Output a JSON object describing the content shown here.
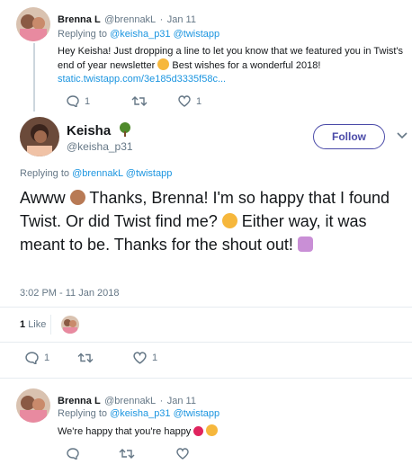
{
  "reply_tweet": {
    "name": "Brenna L",
    "handle": "@brennakL",
    "sep": "·",
    "date": "Jan 11",
    "replying_prefix": "Replying to",
    "replying_to": "@keisha_p31 @twistapp",
    "text_1": "Hey Keisha! Just dropping a line to let you know that we featured you in Twist's",
    "text_2": "end of year newsletter",
    "text_3": "Best wishes for a wonderful 2018!",
    "link": "static.twistapp.com/3e185d3335f58c...",
    "reply_count": "1",
    "like_count": "1"
  },
  "main_tweet": {
    "name": "Keisha",
    "handle": "@keisha_p31",
    "follow_label": "Follow",
    "replying_prefix": "Replying to",
    "replying_to": "@brennakL @twistapp",
    "text_1": "Awww",
    "text_2": "Thanks, Brenna! I'm so happy that I found Twist. Or did Twist find me?",
    "text_3": "Either way, it was meant to be. Thanks for the shout out!",
    "timestamp": "3:02 PM - 11 Jan 2018",
    "likes_count": "1",
    "likes_label": "Like",
    "reply_count": "1",
    "like_count": "1"
  },
  "bottom_tweet": {
    "name": "Brenna L",
    "handle": "@brennakL",
    "sep": "·",
    "date": "Jan 11",
    "replying_prefix": "Replying to",
    "replying_to": "@keisha_p31 @twistapp",
    "text": "We're happy that you're happy"
  },
  "colors": {
    "link": "#1b95e0",
    "follow": "#4a4aa8",
    "muted": "#657786"
  }
}
